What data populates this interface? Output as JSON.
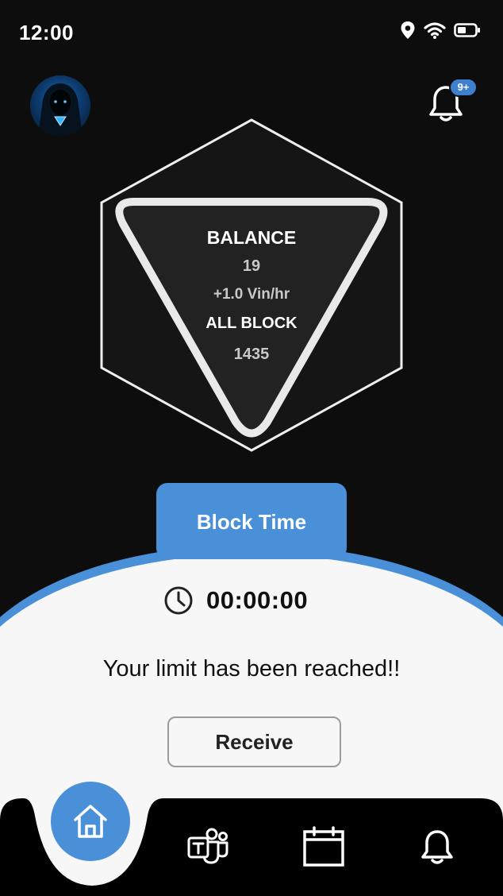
{
  "status_bar": {
    "time": "12:00",
    "icons": [
      "location-icon",
      "wifi-icon",
      "battery-icon"
    ]
  },
  "header": {
    "avatar": "hooded-figure-avatar",
    "notification_badge": "9+"
  },
  "stats": {
    "balance_label": "BALANCE",
    "balance_value": "19",
    "rate": "+1.0 Vin/hr",
    "all_block_label": "ALL BLOCK",
    "all_block_value": "1435"
  },
  "block_time_button": "Block Time",
  "timer": "00:00:00",
  "limit_message": "Your limit has been reached!!",
  "receive_button": "Receive",
  "bottom_nav": {
    "items": [
      "home-icon",
      "teams-icon",
      "calendar-icon",
      "bell-icon"
    ],
    "active": "home-icon"
  },
  "colors": {
    "accent": "#4a90d9",
    "background": "#0d0d0e",
    "panel": "#f7f7f7"
  }
}
